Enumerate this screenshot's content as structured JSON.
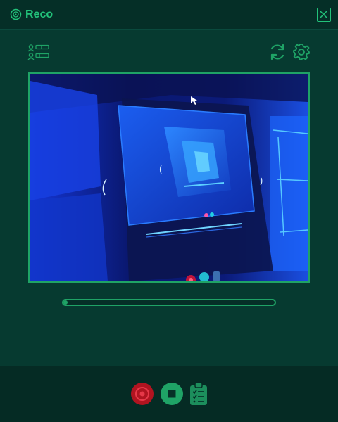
{
  "window": {
    "title": "Reco",
    "logo_icon": "target-logo-icon",
    "close_icon": "close-icon"
  },
  "toolbar": {
    "left_icon": "user-list-icon",
    "refresh_icon": "refresh-icon",
    "settings_icon": "gear-icon"
  },
  "preview": {
    "description_icon": "camera-preview-image"
  },
  "progress": {
    "value": 0.02
  },
  "controls": {
    "record_icon": "record-icon",
    "stop_icon": "stop-icon",
    "clipboard_icon": "clipboard-list-icon"
  },
  "colors": {
    "accent": "#1fa366",
    "title_green": "#22c27a",
    "background": "#063a30",
    "record_red": "#b01420"
  }
}
